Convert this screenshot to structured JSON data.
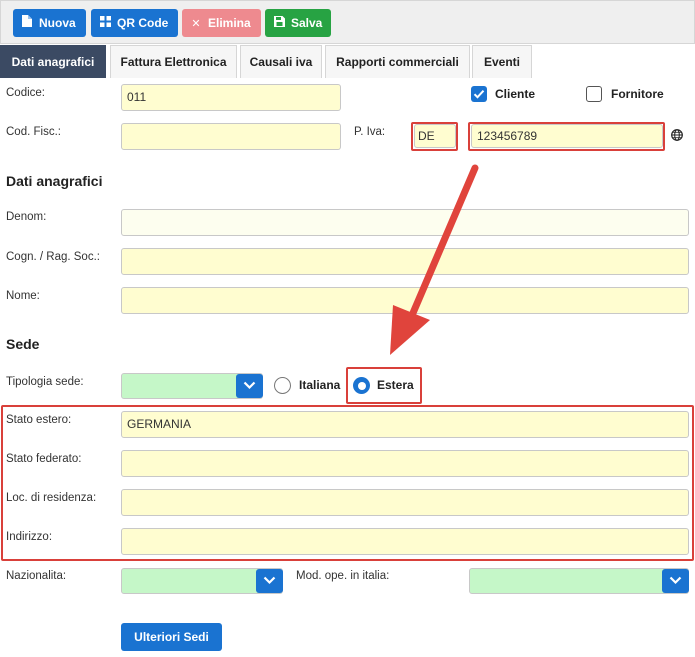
{
  "toolbar": {
    "nuova": "Nuova",
    "qrcode": "QR Code",
    "elimina": "Elimina",
    "salva": "Salva",
    "nuova_icon": "document-icon",
    "qr_icon": "grid-icon",
    "elimina_icon": "x-icon",
    "salva_icon": "floppy-icon"
  },
  "tabs": [
    "Dati anagrafici",
    "Fattura Elettronica",
    "Causali iva",
    "Rapporti commerciali",
    "Eventi"
  ],
  "active_tab": "Dati anagrafici",
  "fields": {
    "codice_label": "Codice:",
    "codice_value": "011",
    "cliente_label": "Cliente",
    "cliente_checked": true,
    "fornitore_label": "Fornitore",
    "fornitore_checked": false,
    "codfisc_label": "Cod. Fisc.:",
    "codfisc_value": "",
    "piva_label": "P. Iva:",
    "piva_country": "DE",
    "piva_value": "123456789"
  },
  "dati_anagrafici": {
    "title": "Dati anagrafici",
    "denom_label": "Denom:",
    "denom_value": "",
    "cognome_label": "Cogn. / Rag. Soc.:",
    "cognome_value": "",
    "nome_label": "Nome:",
    "nome_value": ""
  },
  "sede": {
    "title": "Sede",
    "tipologia_label": "Tipologia sede:",
    "tipologia_value": "",
    "italiana_label": "Italiana",
    "estera_label": "Estera",
    "selected": "Estera",
    "stato_estero_label": "Stato estero:",
    "stato_estero_value": "GERMANIA",
    "stato_federato_label": "Stato federato:",
    "stato_federato_value": "",
    "loc_label": "Loc. di residenza:",
    "loc_value": "",
    "indirizzo_label": "Indirizzo:",
    "indirizzo_value": ""
  },
  "bottom": {
    "nazionalita_label": "Nazionalita:",
    "nazionalita_value": "",
    "modope_label": "Mod. ope. in italia:",
    "modope_value": "",
    "ulteriori_sedi": "Ulteriori Sedi"
  },
  "colors": {
    "primary": "#1a73d1",
    "danger_soft": "#ee8a8f",
    "success": "#27a343",
    "tab_active": "#3b4a63",
    "input_yellow": "#fffdd0",
    "input_green": "#c5f7c8",
    "annotation_red": "#d9403a"
  }
}
